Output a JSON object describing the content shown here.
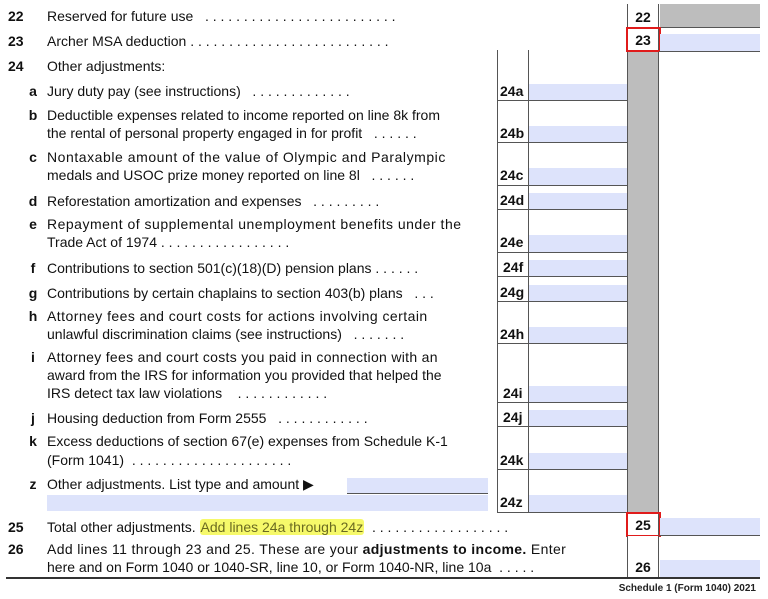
{
  "form": {
    "footer": "Schedule 1 (Form 1040) 2021",
    "colors": {
      "field_fill": "#dde3fb",
      "shade": "#bdbdbd",
      "highlight": "#f6f96a",
      "red_box": "#e01b1b"
    }
  },
  "lines": {
    "l22": {
      "num": "22",
      "text": "Reserved for future use",
      "dots": ". . . . . . . . . . . . . . . . . . . . . . . . .",
      "box": "22",
      "value": ""
    },
    "l23": {
      "num": "23",
      "text": "Archer MSA deduction",
      "dots": ". . . . . . . . . . . . . . . . . . . . . . . . . .",
      "box": "23",
      "value": ""
    },
    "l24": {
      "num": "24",
      "text": "Other adjustments:"
    },
    "a": {
      "letter": "a",
      "text": "Jury duty pay (see instructions)",
      "dots": ". . . . . . . . . . . . .",
      "box": "24a",
      "value": ""
    },
    "b": {
      "letter": "b",
      "line1": "Deductible expenses related to income reported on line 8k from",
      "line2": "the rental of personal property engaged in for profit",
      "dots": ". . . . . .",
      "box": "24b",
      "value": ""
    },
    "c": {
      "letter": "c",
      "line1": "Nontaxable amount of the value of Olympic and Paralympic",
      "line2": "medals and USOC prize money reported on line 8l",
      "dots": ". . . . . .",
      "box": "24c",
      "value": ""
    },
    "d": {
      "letter": "d",
      "text": "Reforestation amortization and expenses",
      "dots": ". . . . . . . . .",
      "box": "24d",
      "value": ""
    },
    "e": {
      "letter": "e",
      "line1": "Repayment of supplemental unemployment benefits under the",
      "line2": "Trade Act of 1974",
      "dots": ". . . . . . . . . . . . . . . . .",
      "box": "24e",
      "value": ""
    },
    "f": {
      "letter": "f",
      "text": "Contributions to section 501(c)(18)(D) pension plans",
      "dots": ". . . . . .",
      "box": "24f",
      "value": ""
    },
    "g": {
      "letter": "g",
      "text": "Contributions by certain chaplains to section 403(b) plans",
      "dots": ". . .",
      "box": "24g",
      "value": ""
    },
    "h": {
      "letter": "h",
      "line1": "Attorney fees and court costs for actions involving certain",
      "line2": "unlawful discrimination claims (see instructions)",
      "dots": ". . . . . . .",
      "box": "24h",
      "value": ""
    },
    "i": {
      "letter": "i",
      "line1": "Attorney fees and court costs you paid in connection with an",
      "line2": "award from the IRS for information you provided that helped the",
      "line3": "IRS detect tax law violations",
      "dots": ". . . . . . . . . . . .",
      "box": "24i",
      "value": ""
    },
    "j": {
      "letter": "j",
      "text": "Housing deduction from Form 2555",
      "dots": ". . . . . . . . . . . .",
      "box": "24j",
      "value": ""
    },
    "k": {
      "letter": "k",
      "line1": "Excess deductions of section 67(e) expenses from Schedule K-1",
      "line2": "(Form 1041)",
      "dots": ". . . . . . . . . . . . . . . . . . . . .",
      "box": "24k",
      "value": ""
    },
    "z": {
      "letter": "z",
      "text": "Other adjustments. List type and amount",
      "arrow": "▶",
      "type_value": "",
      "box": "24z",
      "value": ""
    },
    "l25": {
      "num": "25",
      "text": "Total other adjustments.",
      "highlight": "Add lines 24a through 24z",
      "dots": ". . . . . . . . . . . . . . . . . .",
      "box": "25",
      "value": ""
    },
    "l26": {
      "num": "26",
      "line1_pre": "Add lines 11 through 23 and 25. These are your",
      "line1_bold": "adjustments to income.",
      "line1_post": "Enter",
      "line2": "here and on Form 1040 or 1040-SR, line 10, or Form 1040-NR, line 10a",
      "dots": ". . . . .",
      "box": "26",
      "value": ""
    }
  }
}
